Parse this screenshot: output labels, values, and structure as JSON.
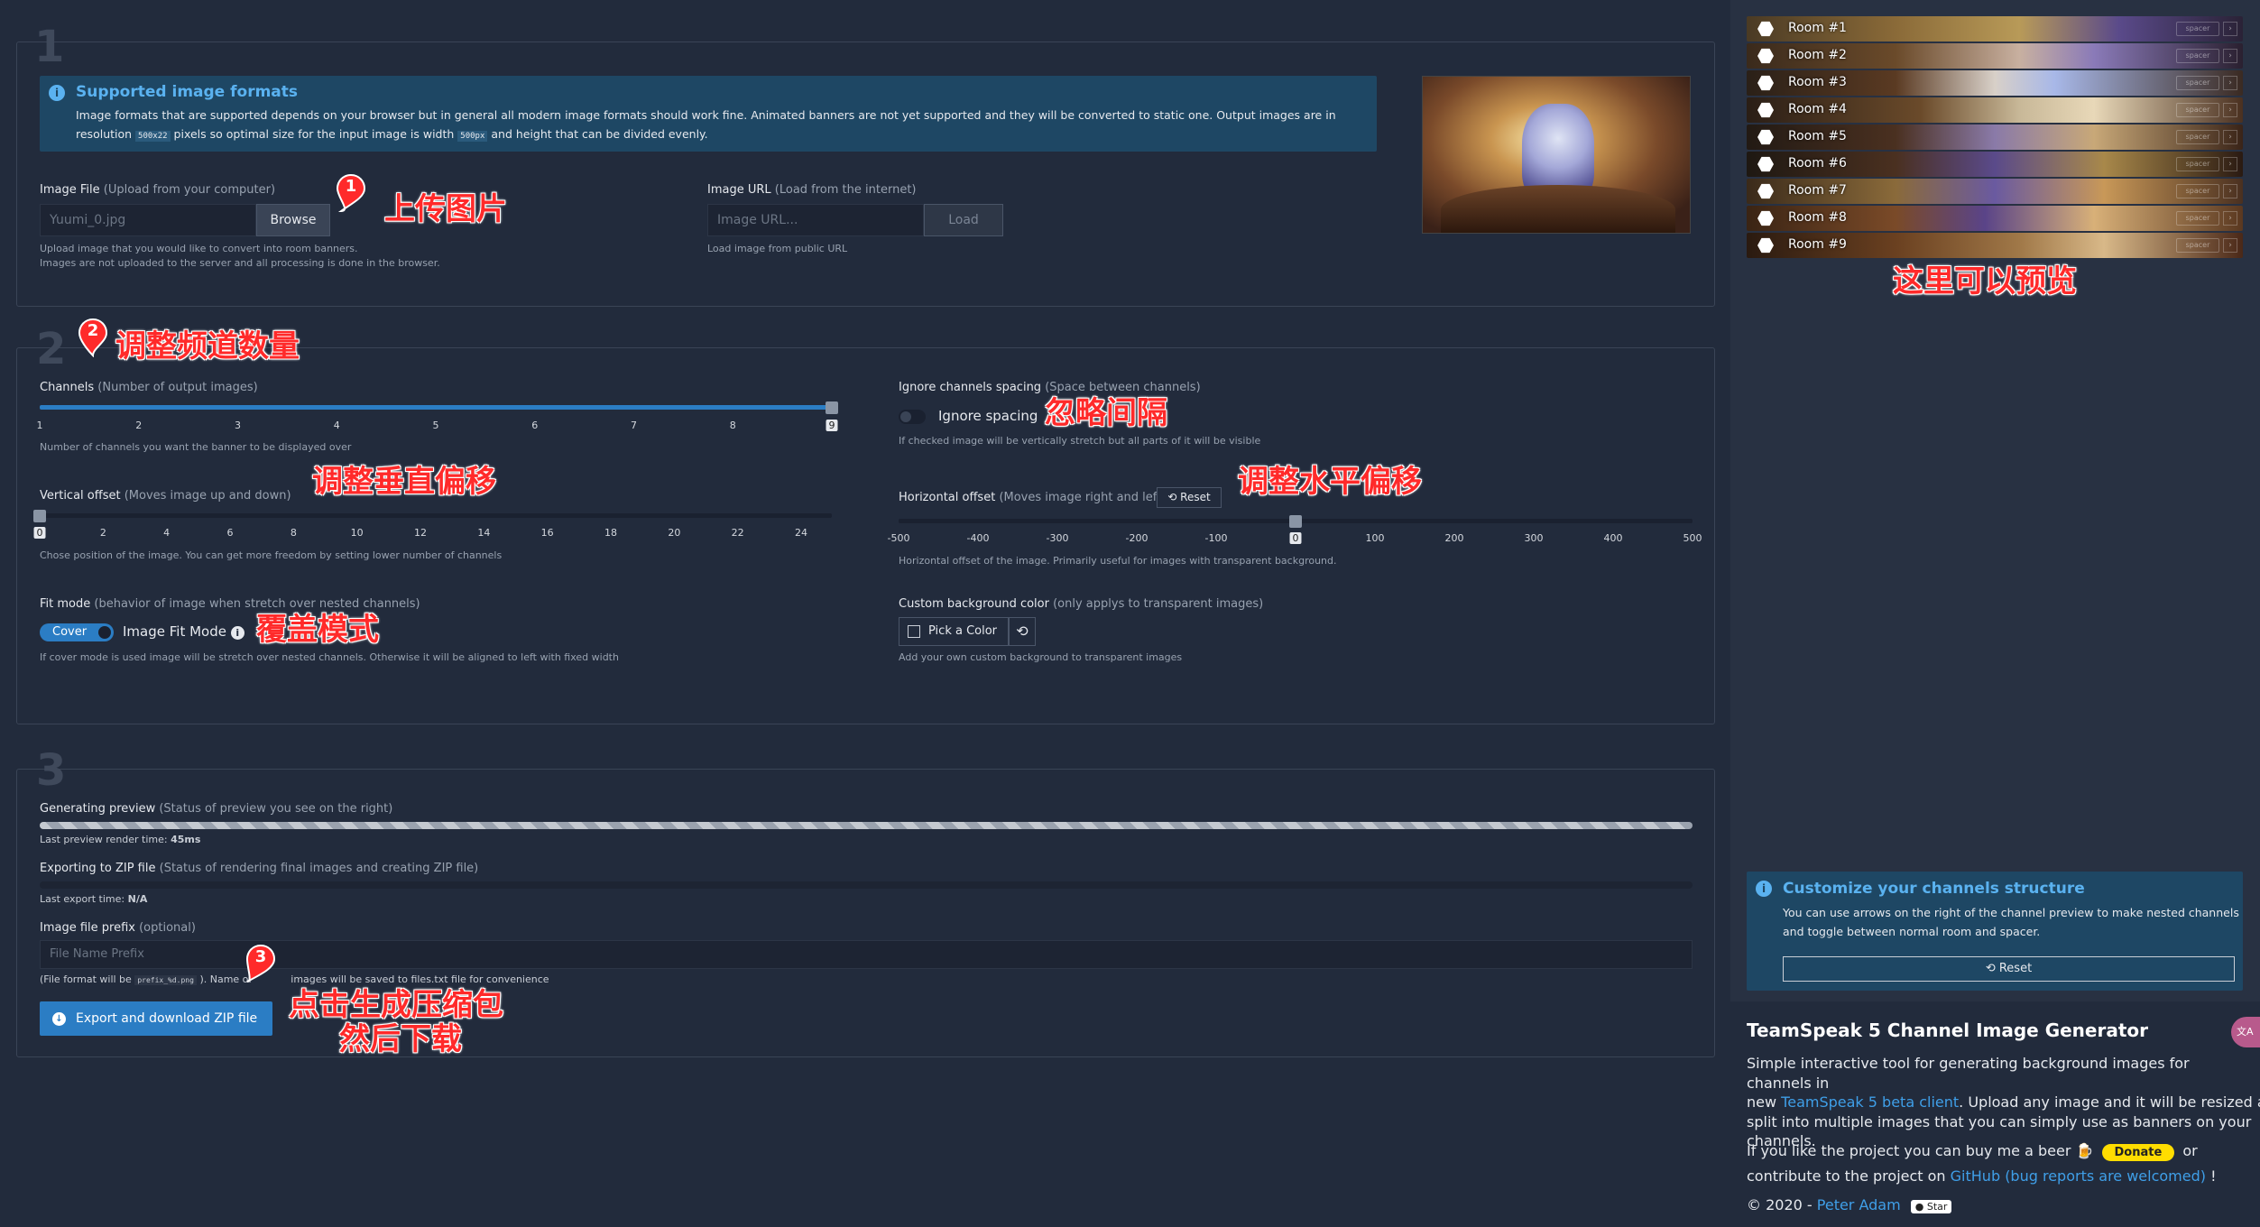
{
  "section1": {
    "number": "1",
    "info_title": "Supported image formats",
    "info_text_1": "Image formats that are supported depends on your browser but in general all modern image formats should work fine. Animated banners are not yet supported and they will be converted to static one. Output images are in",
    "info_text_2a": "resolution",
    "info_code_1": "500x22",
    "info_text_2b": "pixels so optimal size for the input image is width",
    "info_code_2": "500px",
    "info_text_2c": "and height that can be divided evenly.",
    "image_file_label": "Image File",
    "image_file_sub": "(Upload from your computer)",
    "image_file_value": "Yuumi_0.jpg",
    "browse_label": "Browse",
    "image_file_help_1": "Upload image that you would like to convert into room banners.",
    "image_file_help_2": "Images are not uploaded to the server and all processing is done in the browser.",
    "image_url_label": "Image URL",
    "image_url_sub": "(Load from the internet)",
    "image_url_placeholder": "Image URL...",
    "load_label": "Load",
    "image_url_help": "Load image from public URL"
  },
  "section2": {
    "number": "2",
    "channels_label": "Channels",
    "channels_sub": "(Number of output images)",
    "channels_ticks": [
      "1",
      "2",
      "3",
      "4",
      "5",
      "6",
      "7",
      "8",
      "9"
    ],
    "channels_value": 9,
    "channels_help": "Number of channels you want the banner to be displayed over",
    "ignore_label": "Ignore channels spacing",
    "ignore_sub": "(Space between channels)",
    "ignore_toggle_label": "Ignore spacing",
    "ignore_help": "If checked image will be vertically stretch but all parts of it will be visible",
    "voffset_label": "Vertical offset",
    "voffset_sub": "(Moves image up and down)",
    "voffset_ticks": [
      "0",
      "2",
      "4",
      "6",
      "8",
      "10",
      "12",
      "14",
      "16",
      "18",
      "20",
      "22",
      "24"
    ],
    "voffset_value": 0,
    "voffset_help": "Chose position of the image. You can get more freedom by setting lower number of channels",
    "hoffset_label": "Horizontal offset",
    "hoffset_sub": "(Moves image right and left)",
    "hoffset_reset": "Reset",
    "hoffset_ticks": [
      "-500",
      "-400",
      "-300",
      "-200",
      "-100",
      "0",
      "100",
      "200",
      "300",
      "400",
      "500"
    ],
    "hoffset_value": 0,
    "hoffset_help": "Horizontal offset of the image. Primarily useful for images with transparent background.",
    "fit_label": "Fit mode",
    "fit_sub": "(behavior of image when stretch over nested channels)",
    "fit_toggle": "Cover",
    "fit_mode_label": "Image Fit Mode",
    "fit_help": "If cover mode is used image will be stretch over nested channels. Otherwise it will be aligned to left with fixed width",
    "bg_label": "Custom background color",
    "bg_sub": "(only applys to transparent images)",
    "bg_button": "Pick a Color",
    "bg_help": "Add your own custom background to transparent images"
  },
  "section3": {
    "number": "3",
    "preview_label": "Generating preview",
    "preview_sub": "(Status of preview you see on the right)",
    "preview_progress": 1.0,
    "preview_time_label": "Last preview render time:",
    "preview_time_value": "45ms",
    "export_label": "Exporting to ZIP file",
    "export_sub": "(Status of rendering final images and creating ZIP file)",
    "export_progress": 0.0,
    "export_time_label": "Last export time:",
    "export_time_value": "N/A",
    "prefix_label": "Image file prefix",
    "prefix_sub": "(optional)",
    "prefix_placeholder": "File Name Prefix",
    "prefix_help_a": "(File format will be",
    "prefix_help_code": "prefix_%d.png",
    "prefix_help_b": "). Name of",
    "prefix_help_c": "images will be saved to files.txt file for convenience",
    "export_button": "Export and download ZIP file"
  },
  "annotations": {
    "upload": "上传图片",
    "channels": "调整频道数量",
    "ignore": "忽略间隔",
    "voffset": "调整垂直偏移",
    "hoffset": "调整水平偏移",
    "cover": "覆盖模式",
    "export_line1": "点击生成压缩包",
    "export_line2": "然后下载",
    "preview": "这里可以预览",
    "markers": [
      "1",
      "2",
      "3"
    ]
  },
  "sidebar": {
    "rooms": [
      "Room #1",
      "Room #2",
      "Room #3",
      "Room #4",
      "Room #5",
      "Room #6",
      "Room #7",
      "Room #8",
      "Room #9"
    ],
    "spacer_label": "spacer",
    "customize_title": "Customize your channels structure",
    "customize_text_1": "You can use arrows on the right of the channel preview to make nested channels",
    "customize_text_2": "and toggle between normal room and spacer.",
    "customize_reset": "Reset",
    "app_title": "TeamSpeak 5 Channel Image Generator",
    "desc_1": "Simple interactive tool for generating background images for channels in",
    "desc_2a": "new",
    "desc_link": "TeamSpeak 5 beta client",
    "desc_2b": ". Upload any image and it will be resized and",
    "desc_3": "split into multiple images that you can simply use as banners on your",
    "desc_4": "channels.",
    "beer_text": "If you like the project you can buy me a beer",
    "donate_label": "Donate",
    "or_text": "or",
    "contrib_text": "contribute to the project on",
    "github_link": "GitHub (bug reports are welcomed)",
    "contrib_end": "!",
    "copyright": "© 2020 -",
    "author_link": "Peter Adam",
    "star_label": "Star",
    "translate_badge": "文A"
  },
  "colors": {
    "accent": "#2980d4",
    "annotation": "#ff2a2a",
    "donate": "#ffdd00"
  }
}
